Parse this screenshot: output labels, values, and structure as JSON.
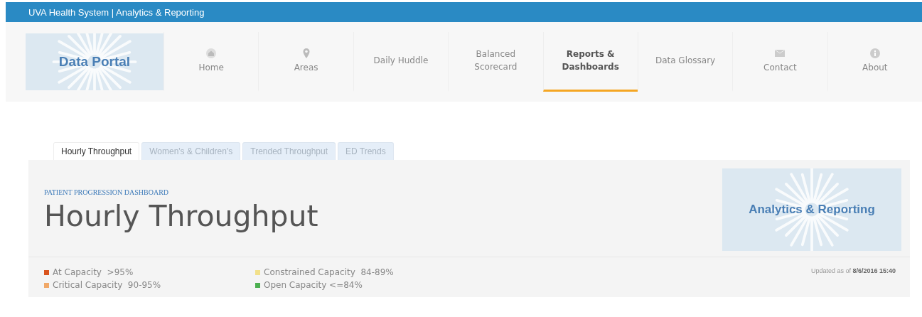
{
  "top_bar": {
    "title": "UVA Health System | Analytics & Reporting"
  },
  "nav": {
    "logo": "Data Portal",
    "items": [
      {
        "label": "Home",
        "kind": "home",
        "selected": false
      },
      {
        "label": "Areas",
        "kind": "pin",
        "selected": false
      },
      {
        "label": "Daily Huddle",
        "kind": "text",
        "selected": false
      },
      {
        "label": "Balanced Scorecard",
        "kind": "text",
        "selected": false
      },
      {
        "label": "Reports & Dashboards",
        "kind": "text",
        "selected": true
      },
      {
        "label": "Data Glossary",
        "kind": "text",
        "selected": false
      },
      {
        "label": "Contact",
        "kind": "mail",
        "selected": false
      },
      {
        "label": "About",
        "kind": "info",
        "selected": false
      }
    ]
  },
  "tabs": [
    {
      "label": "Hourly Throughput",
      "selected": true
    },
    {
      "label": "Women's & Children's",
      "selected": false
    },
    {
      "label": "Trended Throughput",
      "selected": false
    },
    {
      "label": "ED Trends",
      "selected": false
    }
  ],
  "dashboard": {
    "kicker": "PATIENT PROGRESSION DASHBOARD",
    "title": "Hourly Throughput",
    "logo": "Analytics & Reporting",
    "updated": "Updated as of **8/6/2016 15:40**",
    "legend": [
      {
        "label": "At Capacity  >95%",
        "color": "#d9541e"
      },
      {
        "label": "Critical Capacity  90-95%",
        "color": "#f0a868"
      },
      {
        "label": "Constrained Capacity  84-89%",
        "color": "#f2e08a"
      },
      {
        "label": "Open Capacity <=84%",
        "color": "#4caf50"
      }
    ]
  }
}
